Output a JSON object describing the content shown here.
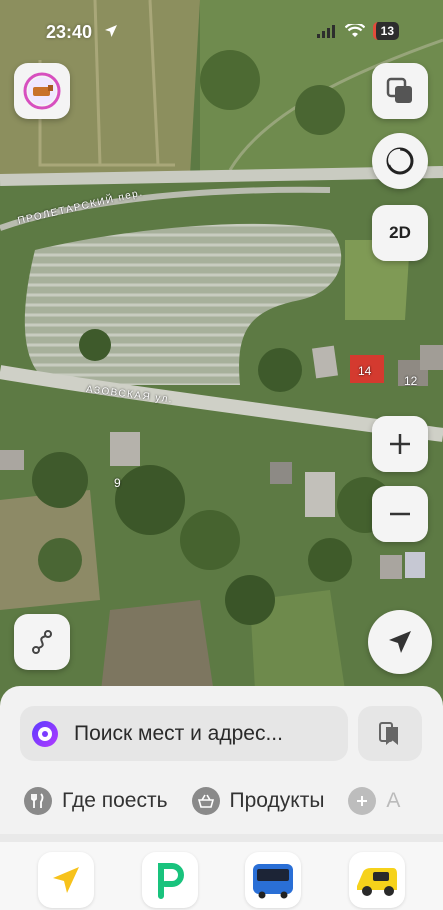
{
  "status_bar": {
    "time": "23:40",
    "battery": "13"
  },
  "map": {
    "streets": [
      "ПРОЛЕТАРСКИЙ пер.",
      "АЗОВСКАЯ ул."
    ],
    "house_numbers": [
      "14",
      "12",
      "9"
    ],
    "mode_label": "2D"
  },
  "search": {
    "placeholder": "Поиск мест и адрес..."
  },
  "categories": [
    {
      "label": "Где поесть",
      "icon": "fork-knife-icon"
    },
    {
      "label": "Продукты",
      "icon": "basket-icon"
    },
    {
      "label": "А",
      "icon": "plus-icon"
    }
  ],
  "apps": [
    "navigator-app",
    "parking-app",
    "transport-app",
    "taxi-app"
  ],
  "colors": {
    "alice_accent": "#7a3bff",
    "sheet_bg": "#f2f2f2",
    "roof_red": "#d43a2f"
  }
}
